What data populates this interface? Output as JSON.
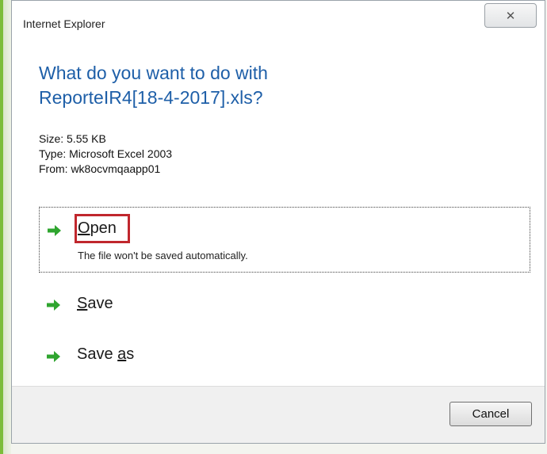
{
  "window": {
    "title": "Internet Explorer",
    "close_label": "✕"
  },
  "dialog": {
    "question_line1": "What do you want to do with",
    "question_line2": "ReporteIR4[18-4-2017].xls?",
    "size": "Size: 5.55 KB",
    "type": "Type: Microsoft Excel 2003",
    "from": "From: wk8ocvmqaapp01"
  },
  "options": {
    "open": {
      "label_first": "O",
      "label_rest": "pen",
      "description": "The file won't be saved automatically."
    },
    "save": {
      "label_first": "S",
      "label_rest": "ave"
    },
    "save_as": {
      "label_before": "Save ",
      "label_ul": "a",
      "label_after": "s"
    }
  },
  "footer": {
    "cancel_label": "Cancel"
  },
  "colors": {
    "accent_blue": "#1e5fa8",
    "arrow_green": "#2fa52f",
    "highlight_red": "#c0272d",
    "backdrop_green": "#7cbd3a"
  },
  "icons": {
    "option_arrow": "green-right-arrow-icon",
    "close": "close-icon"
  }
}
